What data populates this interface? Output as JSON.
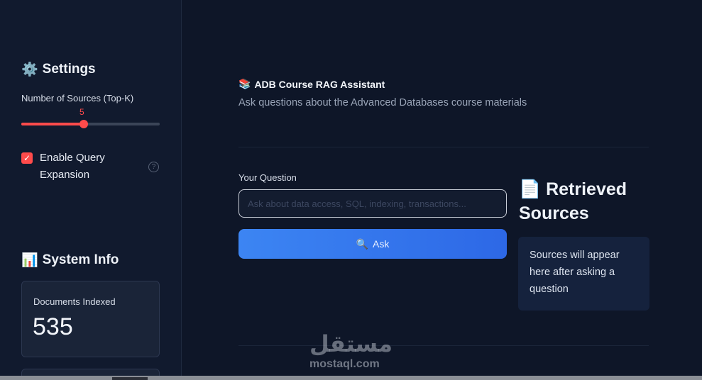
{
  "sidebar": {
    "settings": {
      "icon": "gear-icon",
      "title": "Settings"
    },
    "top_k": {
      "label": "Number of Sources (Top-K)",
      "value": "5",
      "fraction": 0.45
    },
    "query_expansion": {
      "label": "Enable Query Expansion",
      "checked": true
    },
    "system_info": {
      "icon": "bar-chart-icon",
      "title": "System Info"
    },
    "metrics": {
      "documents_label": "Documents Indexed",
      "documents_value": "535"
    }
  },
  "main": {
    "title_icon": "books-icon",
    "title": "ADB Course RAG Assistant",
    "subtitle": "Ask questions about the Advanced Databases course materials",
    "question_label": "Your Question",
    "question_placeholder": "Ask about data access, SQL, indexing, transactions...",
    "question_value": "",
    "ask_label": "Ask",
    "ask_icon": "search-icon"
  },
  "sources": {
    "icon": "document-icon",
    "title": "Retrieved Sources",
    "empty_text": "Sources will appear here after asking a question"
  },
  "watermark": {
    "arabic": "مستقل",
    "latin": "mostaql.com"
  },
  "colors": {
    "accent": "#ff4b4b",
    "button": "#3c85f3",
    "background": "#0e1628",
    "sidebar": "#111a2e"
  }
}
